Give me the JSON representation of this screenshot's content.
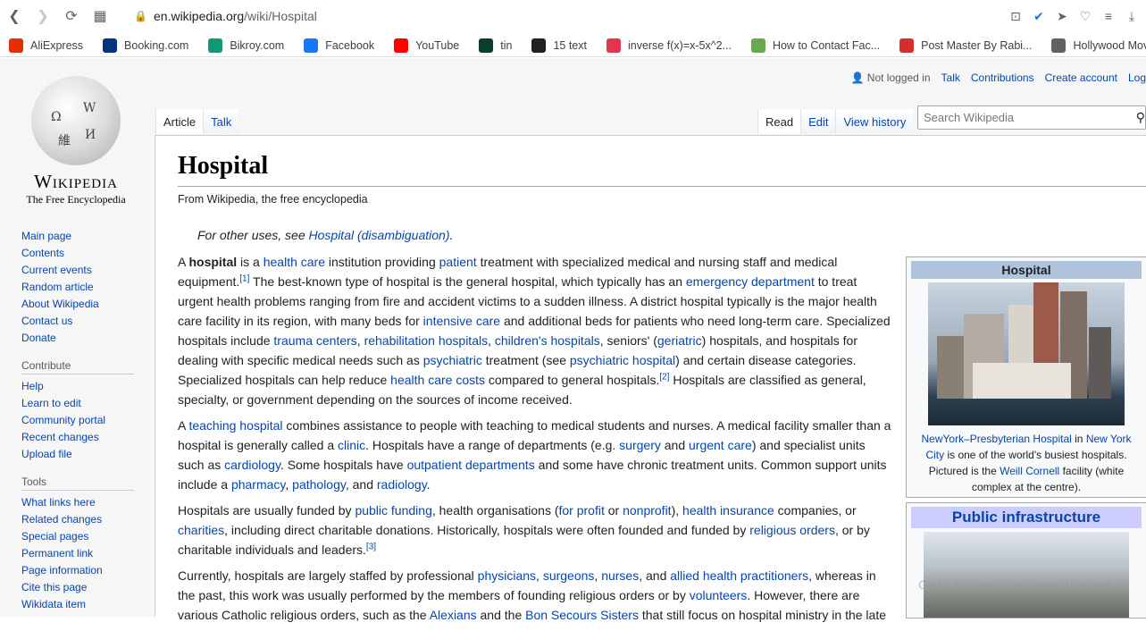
{
  "browser": {
    "url_host": "en.wikipedia.org",
    "url_path": "/wiki/Hospital",
    "bookmarks": [
      {
        "label": "AliExpress",
        "color": "#e62e04"
      },
      {
        "label": "Booking.com",
        "color": "#003580"
      },
      {
        "label": "Bikroy.com",
        "color": "#149777"
      },
      {
        "label": "Facebook",
        "color": "#1877f2"
      },
      {
        "label": "YouTube",
        "color": "#ff0000"
      },
      {
        "label": "tin",
        "color": "#0b3d2e"
      },
      {
        "label": "15 text",
        "color": "#202124"
      },
      {
        "label": "inverse f(x)=x-5x^2...",
        "color": "#e2364f"
      },
      {
        "label": "How to Contact Fac...",
        "color": "#6aa84f"
      },
      {
        "label": "Post Master By Rabi...",
        "color": "#d32f2f"
      },
      {
        "label": "Hollywood Movies |...",
        "color": "#5f6368"
      }
    ]
  },
  "wiki": {
    "wordmark": "Wikipedia",
    "tagline": "The Free Encyclopedia",
    "personal": {
      "not_logged_in": "Not logged in",
      "talk": "Talk",
      "contributions": "Contributions",
      "create_account": "Create account",
      "login": "Log"
    },
    "tabs_left": [
      "Article",
      "Talk"
    ],
    "tabs_right": [
      "Read",
      "Edit",
      "View history"
    ],
    "search_placeholder": "Search Wikipedia",
    "nav_main": [
      "Main page",
      "Contents",
      "Current events",
      "Random article",
      "About Wikipedia",
      "Contact us",
      "Donate"
    ],
    "contribute_heading": "Contribute",
    "nav_contribute": [
      "Help",
      "Learn to edit",
      "Community portal",
      "Recent changes",
      "Upload file"
    ],
    "tools_heading": "Tools",
    "nav_tools": [
      "What links here",
      "Related changes",
      "Special pages",
      "Permanent link",
      "Page information",
      "Cite this page",
      "Wikidata item"
    ],
    "title": "Hospital",
    "from": "From Wikipedia, the free encyclopedia",
    "hatnote_prefix": "For other uses, see ",
    "hatnote_link": "Hospital (disambiguation)",
    "hatnote_suffix": ".",
    "infobox": {
      "title": "Hospital",
      "caption_link1": "NewYork–Presbyterian Hospital",
      "caption_in": " in ",
      "caption_link2": "New York City",
      "caption_mid": " is one of the world's busiest hospitals. Pictured is the ",
      "caption_link3": "Weill Cornell",
      "caption_end": " facility (white complex at the centre)."
    },
    "infobox2_title": "Public infrastructure",
    "watermark": "Go to Settings to activate Windows."
  }
}
